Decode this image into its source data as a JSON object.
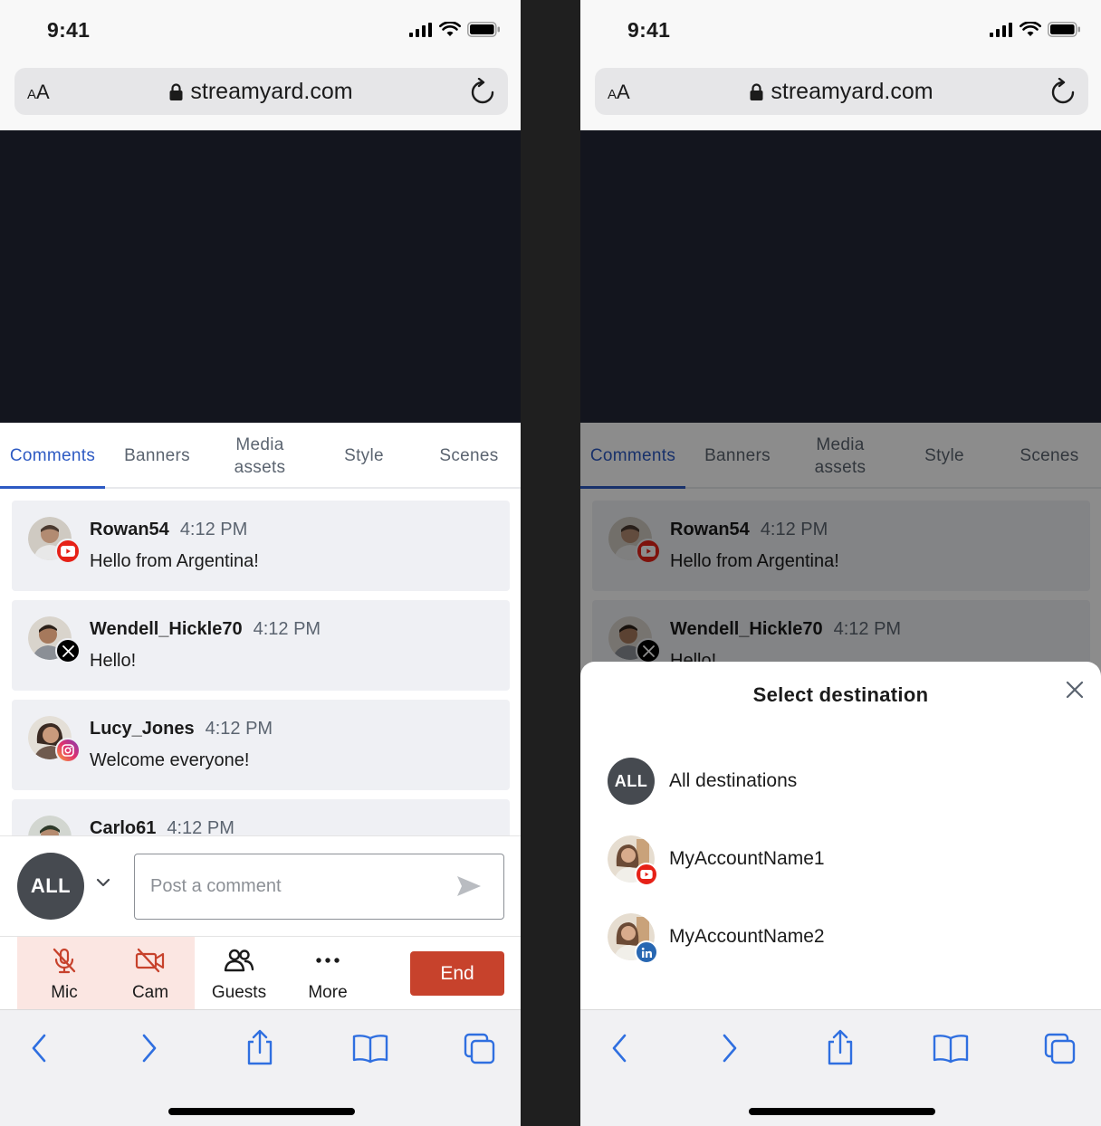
{
  "status": {
    "time": "9:41"
  },
  "browser": {
    "url": "streamyard.com",
    "aa_small": "A",
    "aa_large": "A"
  },
  "tabs": [
    {
      "label": "Comments",
      "active": true
    },
    {
      "label": "Banners",
      "active": false
    },
    {
      "label": "Media assets",
      "active": false
    },
    {
      "label": "Style",
      "active": false
    },
    {
      "label": "Scenes",
      "active": false
    }
  ],
  "comments": [
    {
      "author": "Rowan54",
      "time": "4:12 PM",
      "text": "Hello from Argentina!",
      "platform": "youtube"
    },
    {
      "author": "Wendell_Hickle70",
      "time": "4:12 PM",
      "text": "Hello!",
      "platform": "x"
    },
    {
      "author": "Lucy_Jones",
      "time": "4:12 PM",
      "text": "Welcome everyone!",
      "platform": "instagram"
    },
    {
      "author": "Carlo61",
      "time": "4:12 PM",
      "text": "",
      "platform": "none"
    }
  ],
  "composer": {
    "destination": "ALL",
    "placeholder": "Post a comment"
  },
  "controls": {
    "mic": "Mic",
    "cam": "Cam",
    "guests": "Guests",
    "more": "More",
    "end": "End"
  },
  "sheet": {
    "title": "Select destination",
    "destinations": [
      {
        "label": "All destinations",
        "avatar_text": "ALL"
      },
      {
        "label": "MyAccountName1",
        "platform": "youtube"
      },
      {
        "label": "MyAccountName2",
        "platform": "linkedin"
      }
    ]
  },
  "colors": {
    "accent": "#2d5ac3",
    "end_button": "#c7422c",
    "muted_bg": "#fbe6e2",
    "youtube": "#e62117",
    "linkedin": "#2867b2"
  }
}
